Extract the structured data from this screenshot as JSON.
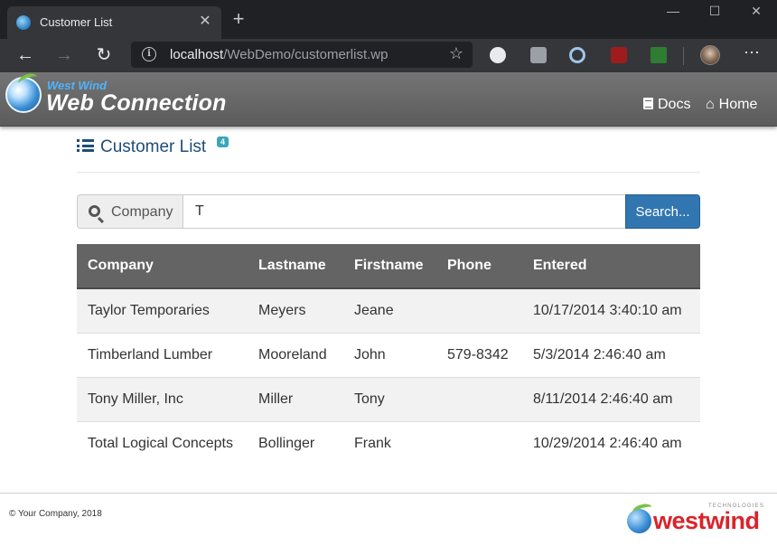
{
  "browser": {
    "tab_title": "Customer List",
    "url_host": "localhost",
    "url_path": "/WebDemo/customerlist.wp"
  },
  "header": {
    "brand_small": "West Wind",
    "brand_big": "Web Connection",
    "nav": [
      {
        "label": "Docs",
        "icon": "book-icon"
      },
      {
        "label": "Home",
        "icon": "home-icon"
      }
    ]
  },
  "page": {
    "title": "Customer List",
    "count_badge": "4"
  },
  "search": {
    "addon_label": "Company",
    "value": "T",
    "button_label": "Search..."
  },
  "table": {
    "columns": [
      "Company",
      "Lastname",
      "Firstname",
      "Phone",
      "Entered"
    ],
    "rows": [
      [
        "Taylor Temporaries",
        "Meyers",
        "Jeane",
        "",
        "10/17/2014 3:40:10 am"
      ],
      [
        "Timberland Lumber",
        "Mooreland",
        "John",
        "579-8342",
        "5/3/2014 2:46:40 am"
      ],
      [
        "Tony Miller, Inc",
        "Miller",
        "Tony",
        "",
        "8/11/2014 2:46:40 am"
      ],
      [
        "Total Logical Concepts",
        "Bollinger",
        "Frank",
        "",
        "10/29/2014 2:46:40 am"
      ]
    ]
  },
  "footer": {
    "copyright": "© Your Company, 2018",
    "logo_text": "westwind",
    "logo_tagline": "TECHNOLOGIES"
  },
  "colors": {
    "header_bg": "#646464",
    "title": "#1f4e79",
    "search_button": "#3276b1",
    "badge": "#3aa6b9",
    "logo_red": "#d9242b"
  }
}
